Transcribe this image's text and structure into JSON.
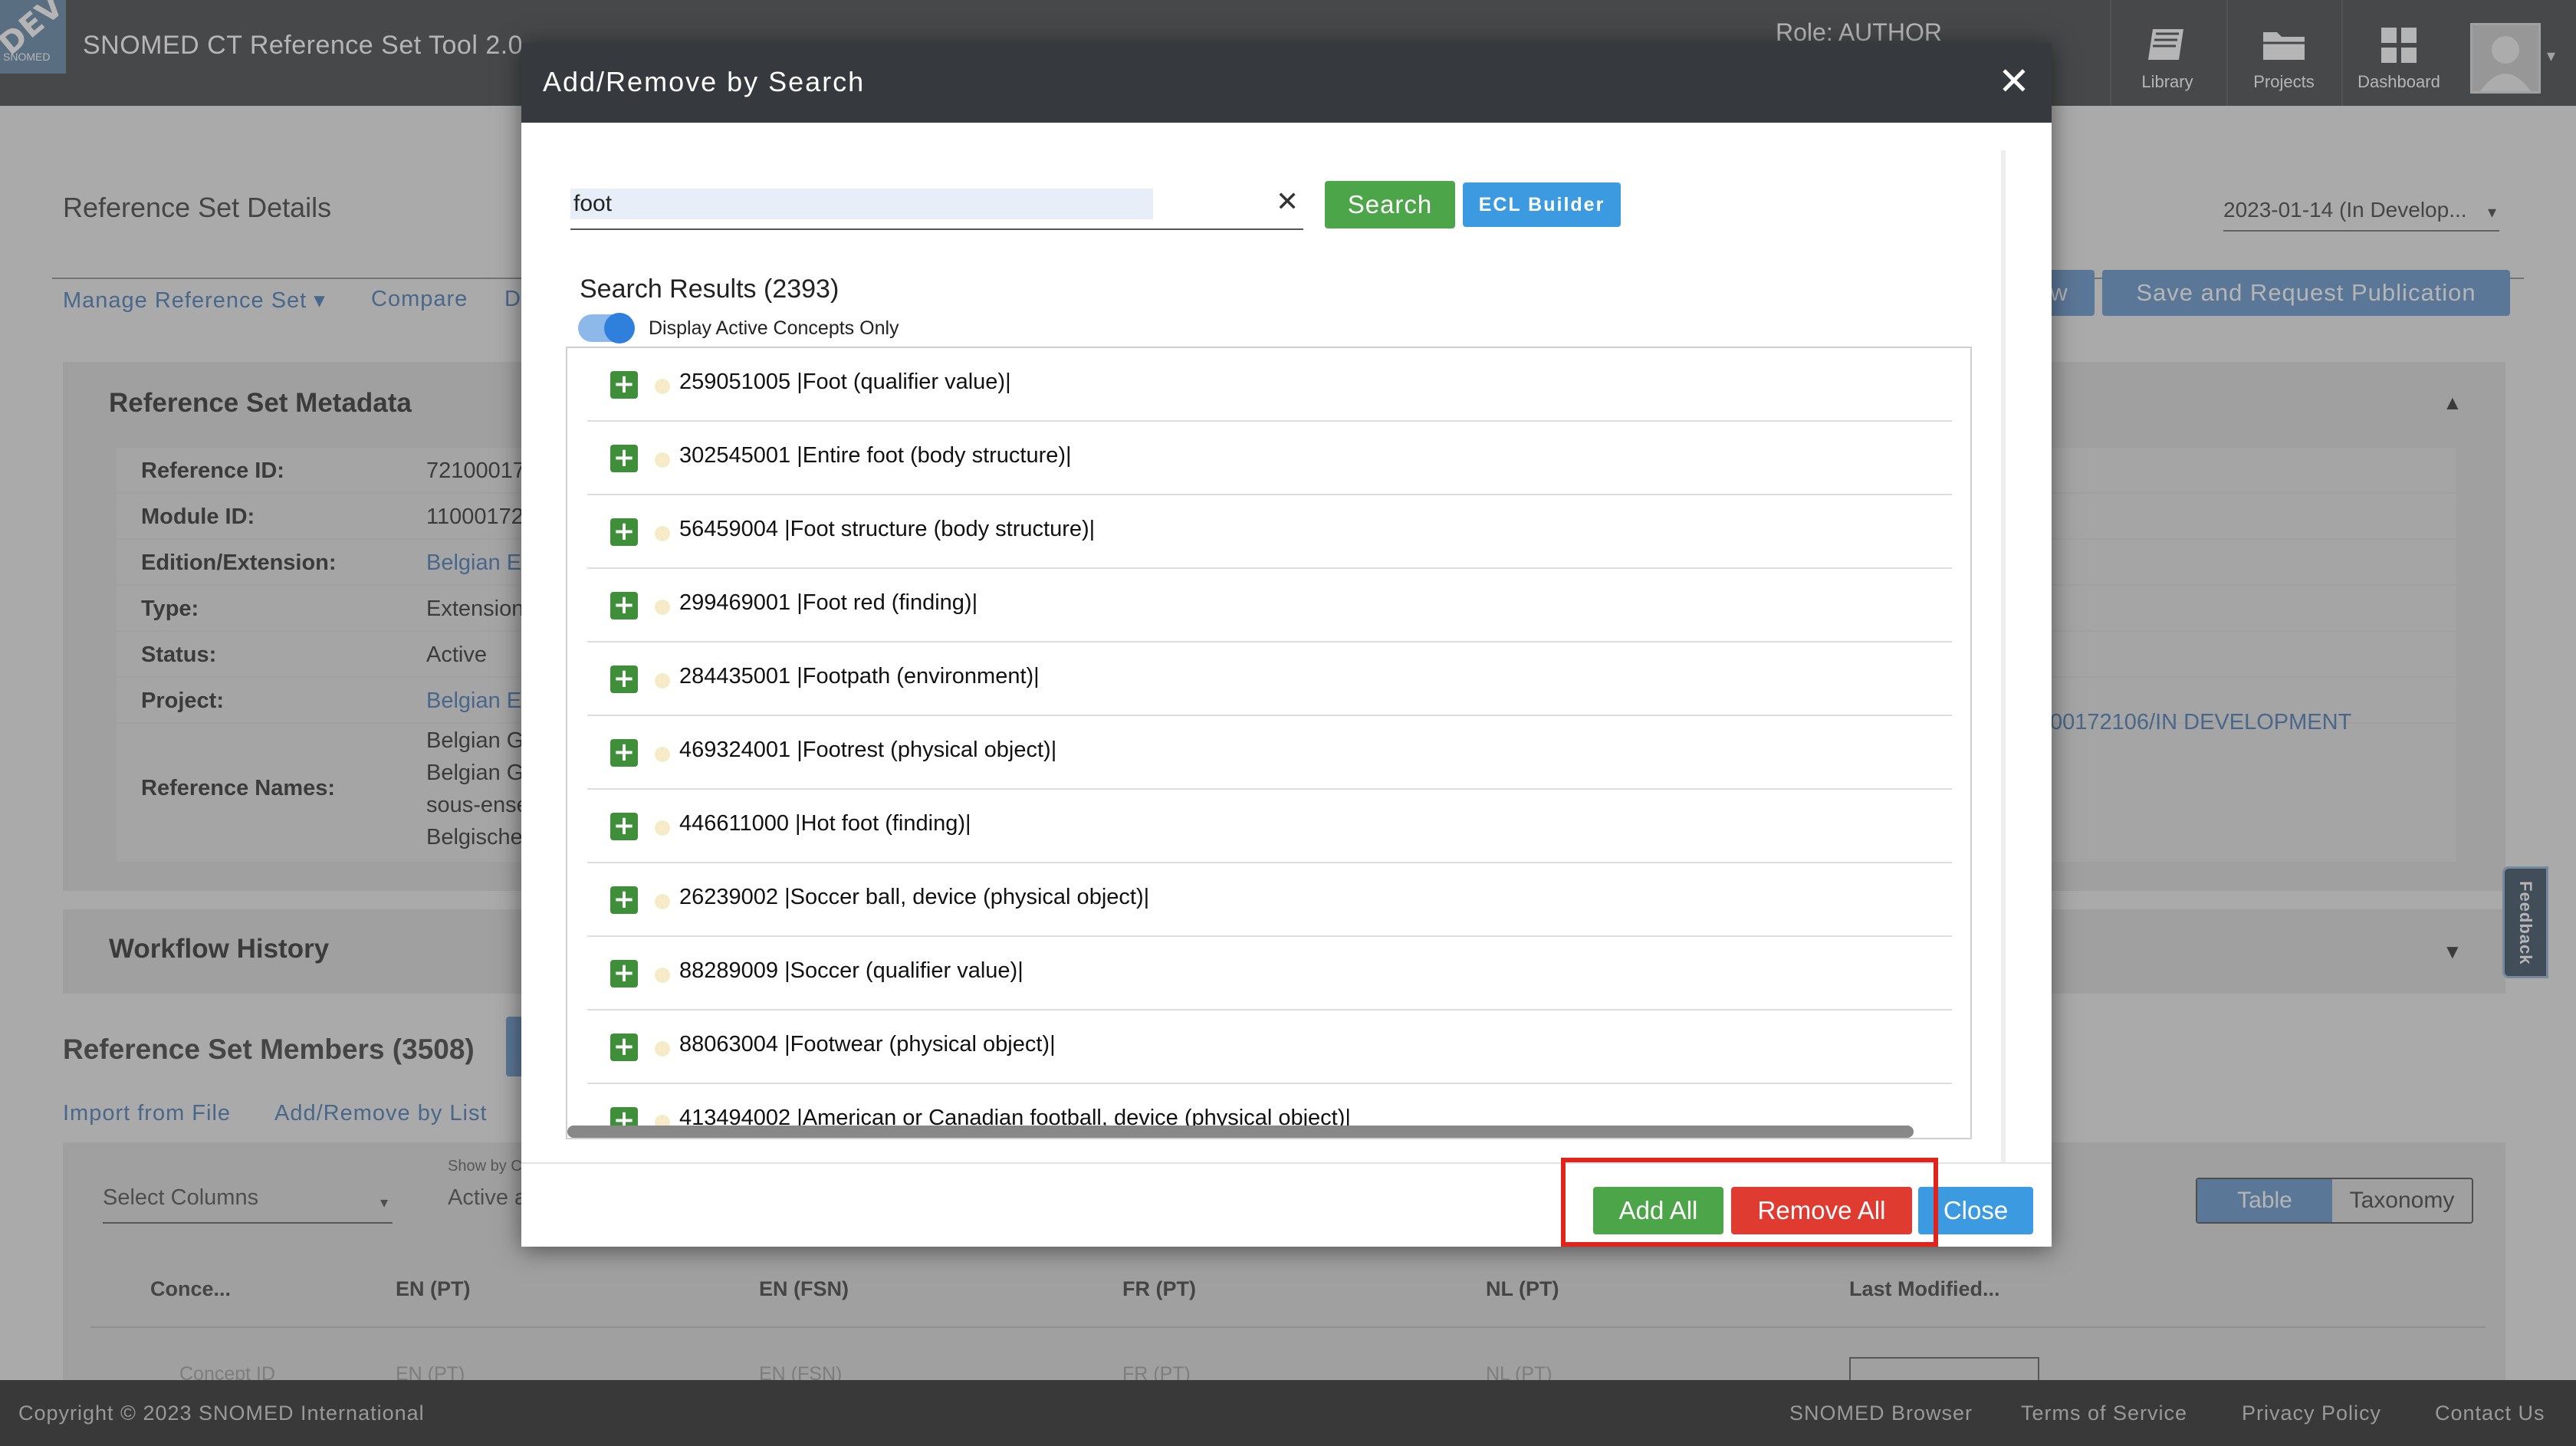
{
  "app": {
    "title": "SNOMED CT Reference Set Tool 2.0",
    "env_badge": "DEV",
    "logo_text": "SNOMED",
    "role": "Role: AUTHOR"
  },
  "nav": [
    {
      "label": "Library",
      "icon": "library-icon"
    },
    {
      "label": "Projects",
      "icon": "folder-icon"
    },
    {
      "label": "Dashboard",
      "icon": "dashboard-icon"
    }
  ],
  "page": {
    "heading": "Reference Set Details",
    "version": "2023-01-14 (In Develop...",
    "subnav": [
      "Manage Reference Set ▾",
      "Compare",
      "D"
    ],
    "save_button": "Save and Request Publication",
    "partial_button": "w",
    "project_path": "00172106/IN DEVELOPMENT"
  },
  "metadata": {
    "title": "Reference Set Metadata",
    "rows": [
      {
        "label": "Reference ID:",
        "value": "72100017",
        "link": false
      },
      {
        "label": "Module ID:",
        "value": "11000172",
        "link": false
      },
      {
        "label": "Edition/Extension:",
        "value": "Belgian E",
        "link": true
      },
      {
        "label": "Type:",
        "value": "Extension",
        "link": false
      },
      {
        "label": "Status:",
        "value": "Active",
        "link": false
      },
      {
        "label": "Project:",
        "value": "Belgian E",
        "link": true
      }
    ],
    "names_label": "Reference Names:",
    "names": [
      "Belgian G",
      "Belgian G",
      "sous-ense",
      "Belgische"
    ]
  },
  "workflow": {
    "title": "Workflow History"
  },
  "members": {
    "title": "Reference Set Members (3508)",
    "links": [
      "Import from File",
      "Add/Remove by List"
    ],
    "select_columns": "Select Columns",
    "show_by_label": "Show by C",
    "show_by_value": "Active a",
    "view_tabs": [
      "Table",
      "Taxonomy"
    ],
    "columns": [
      "Conce...",
      "EN (PT)",
      "EN (FSN)",
      "FR (PT)",
      "NL (PT)",
      "Last Modified..."
    ],
    "filter_placeholders": [
      "Concept ID",
      "EN (PT)",
      "EN (FSN)",
      "FR (PT)",
      "NL (PT)"
    ]
  },
  "footer": {
    "copyright": "Copyright © 2023 SNOMED International",
    "links": [
      "SNOMED Browser",
      "Terms of Service",
      "Privacy Policy",
      "Contact Us"
    ]
  },
  "modal": {
    "title": "Add/Remove by Search",
    "search_value": "foot",
    "search_button": "Search",
    "ecl_button": "ECL Builder",
    "results_title": "Search Results (2393)",
    "toggle_label": "Display Active Concepts Only",
    "toggle_on": true,
    "results": [
      "259051005 |Foot (qualifier value)|",
      "302545001 |Entire foot (body structure)|",
      "56459004 |Foot structure (body structure)|",
      "299469001 |Foot red (finding)|",
      "284435001 |Footpath (environment)|",
      "469324001 |Footrest (physical object)|",
      "446611000 |Hot foot (finding)|",
      "26239002 |Soccer ball, device (physical object)|",
      "88289009 |Soccer (qualifier value)|",
      "88063004 |Footwear (physical object)|",
      "413494002 |American or Canadian football, device (physical object)|"
    ],
    "add_all": "Add All",
    "remove_all": "Remove All",
    "close": "Close"
  },
  "feedback": "Feedback",
  "colors": {
    "accent_green": "#4ca548",
    "danger_red": "#e03b30",
    "primary_blue": "#3c9be0",
    "header_dark": "#36393d",
    "highlight": "#e0231b"
  }
}
